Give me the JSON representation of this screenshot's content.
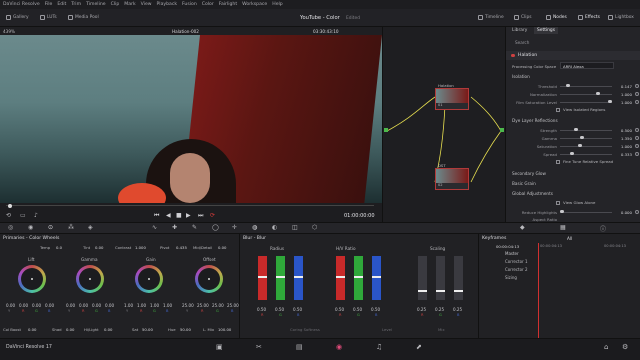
{
  "menu": [
    "DaVinci Resolve",
    "File",
    "Edit",
    "Trim",
    "Timeline",
    "Clip",
    "Mark",
    "View",
    "Playback",
    "Fusion",
    "Color",
    "Fairlight",
    "Workspace",
    "Help"
  ],
  "toolbar": {
    "gallery": "Gallery",
    "luts": "LUTs",
    "media_pool": "Media Pool",
    "project_title": "YouTube - Color",
    "edited": "Edited",
    "timeline": "Timeline",
    "clips": "Clips",
    "nodes": "Nodes",
    "effects": "Effects",
    "lightbox": "Lightbox"
  },
  "viewer": {
    "zoom": "439%",
    "clip_name": "Halation-002",
    "timecode": "03:30:43:10",
    "fit": "Clip",
    "playhead": "01:00:00:00"
  },
  "nodes": {
    "node1_label": "Halation",
    "node1_num": "01",
    "node2_label": "DST",
    "node2_num": "02"
  },
  "settings": {
    "tab_library": "Library",
    "tab_settings": "Settings",
    "search": "Search",
    "effect": "Halation",
    "processing_label": "Processing Color Space",
    "processing_value": "ARRI Alexa",
    "isolation": "Isolation",
    "threshold_label": "Threshold",
    "threshold": "0.147",
    "normalization_label": "Normalization",
    "normalization": "1.000",
    "film_sat_label": "Film Saturation Level",
    "film_sat": "1.000",
    "view_isolated": "View Isolated Regions",
    "dye_layer": "Dye Layer Reflections",
    "strength_label": "Strength",
    "strength": "0.500",
    "gamma_label": "Gamma",
    "gamma": "1.350",
    "saturation_label": "Saturation",
    "saturation": "1.000",
    "spread_label": "Spread",
    "spread": "0.333",
    "fine_tune": "Fine Tune Relative Spread",
    "secondary_glow": "Secondary Glow",
    "basic_grain": "Basic Grain",
    "global_adj": "Global Adjustments",
    "view_glow": "View Glow Alone",
    "reduce_label": "Reduce Highlights",
    "reduce": "0.000",
    "aspect_label": "Aspect Ratio"
  },
  "primaries": {
    "title": "Primaries - Color Wheels",
    "temp_label": "Temp",
    "temp": "0.0",
    "tint_label": "Tint",
    "tint": "0.00",
    "contrast_label": "Contrast",
    "contrast": "1.000",
    "pivot_label": "Pivot",
    "pivot": "0.435",
    "md_label": "Mid/Detail",
    "md": "0.00",
    "wheels": [
      {
        "name": "Lift",
        "v": [
          "0.00",
          "0.00",
          "0.00",
          "0.00"
        ]
      },
      {
        "name": "Gamma",
        "v": [
          "0.00",
          "0.00",
          "0.00",
          "0.00"
        ]
      },
      {
        "name": "Gain",
        "v": [
          "1.00",
          "1.00",
          "1.00",
          "1.00"
        ]
      },
      {
        "name": "Offset",
        "v": [
          "25.00",
          "25.00",
          "25.00",
          "25.00"
        ]
      }
    ],
    "channels": [
      "Y",
      "R",
      "G",
      "B"
    ],
    "col_boost_label": "Col Boost",
    "col_boost": "0.00",
    "shad_label": "Shad",
    "shad": "0.00",
    "hilight_label": "Hi/Light",
    "hilight": "0.00",
    "sat_label": "Sat",
    "sat": "50.00",
    "hue_label": "Hue",
    "hue": "50.00",
    "lmix_label": "L. Mix",
    "lmix": "100.00"
  },
  "blur": {
    "title": "Blur - Blur",
    "radius_label": "Radius",
    "hv_label": "H/V Ratio",
    "scaling_label": "Scaling",
    "radius": [
      "0.50",
      "0.50",
      "0.50"
    ],
    "hv": [
      "0.50",
      "0.50",
      "0.50"
    ],
    "scaling": [
      "0.25",
      "0.25",
      "0.25"
    ],
    "rgb": [
      "R",
      "G",
      "B"
    ],
    "coring_label": "Coring Softness",
    "level_label": "Level",
    "mix_label": "Mix"
  },
  "keyframes": {
    "title": "Keyframes",
    "all": "All",
    "tc": "00:00:04:13",
    "tc2": "00:00:04:13",
    "tc3": "00:00:04:13",
    "master": "Master",
    "c1": "Corrector 1",
    "c2": "Corrector 2",
    "sizing": "Sizing"
  },
  "footer": {
    "app": "DaVinci Resolve 17"
  }
}
